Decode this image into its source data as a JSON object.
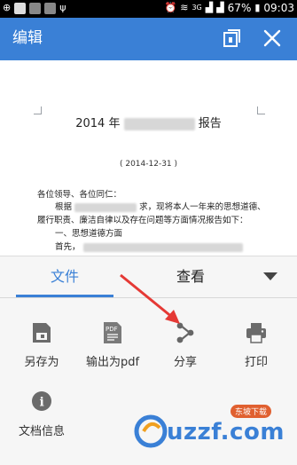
{
  "status_bar": {
    "signal_3g": "3G",
    "battery": "67%",
    "time": "09:03"
  },
  "app_bar": {
    "title": "编辑"
  },
  "document": {
    "title_left": "2014 年",
    "title_right": "报告",
    "date": "( 2014-12-31 )",
    "greeting": "各位领导、各位同仁：",
    "line1_left": "根据",
    "line1_right": "求，现将本人一年来的思想道德、",
    "line2": "履行职责、廉洁自律以及存在问题等方面情况报告如下：",
    "line3": "一、思想道德方面",
    "line4": "首先，"
  },
  "sheet": {
    "tabs": [
      {
        "label": "文件"
      },
      {
        "label": "查看"
      }
    ],
    "actions": [
      {
        "label": "另存为",
        "icon": "save-as-icon"
      },
      {
        "label": "输出为pdf",
        "icon": "pdf-icon",
        "badge": "PDF"
      },
      {
        "label": "分享",
        "icon": "share-icon"
      },
      {
        "label": "打印",
        "icon": "print-icon"
      },
      {
        "label": "文档信息",
        "icon": "info-icon",
        "glyph": "i"
      }
    ]
  },
  "watermark": {
    "text": "uzzf.com",
    "badge": "东坡下载"
  },
  "colors": {
    "accent": "#3a80d6",
    "arrow": "#e53935"
  }
}
